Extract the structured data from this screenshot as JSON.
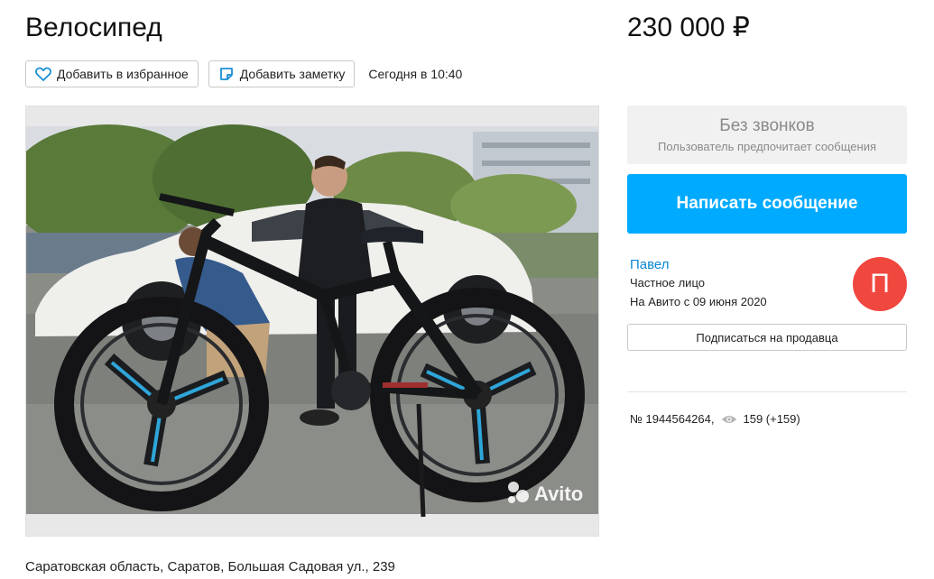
{
  "listing": {
    "title": "Велосипед",
    "price": "230 000 ₽",
    "posted": "Сегодня в 10:40",
    "address": "Саратовская область, Саратов, Большая Садовая ул., 239"
  },
  "toolbar": {
    "favorite_label": "Добавить в избранное",
    "note_label": "Добавить заметку",
    "favorite_icon": "heart-icon",
    "note_icon": "note-icon"
  },
  "gallery": {
    "watermark": "Avito",
    "accent": "#2ea6d9"
  },
  "contact": {
    "no_calls_title": "Без звонков",
    "no_calls_subtitle": "Пользователь предпочитает сообщения",
    "message_button": "Написать сообщение",
    "button_color": "#00aaff"
  },
  "seller": {
    "name": "Павел",
    "type": "Частное лицо",
    "since": "На Авито с 09 июня 2020",
    "avatar_letter": "П",
    "avatar_color": "#f0473e",
    "subscribe_label": "Подписаться на продавца"
  },
  "stats": {
    "item_number": "№ 1944564264,",
    "views": "159 (+159)",
    "views_icon": "eye-icon"
  }
}
